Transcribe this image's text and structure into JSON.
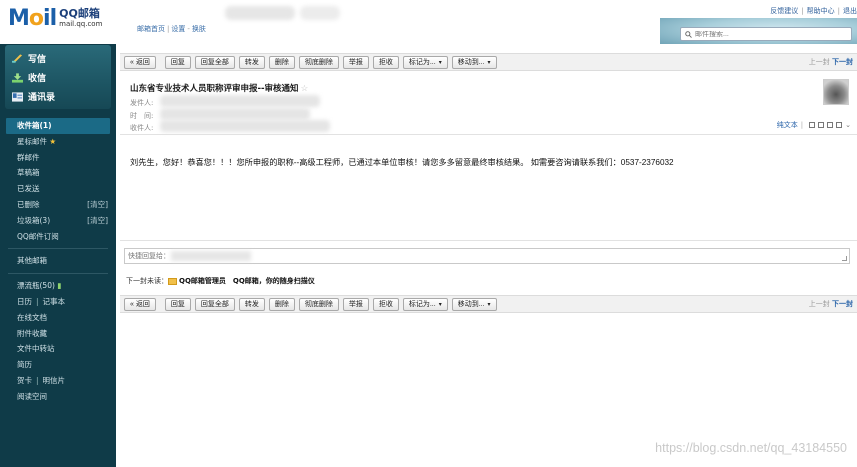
{
  "header": {
    "logo_mail": "MAil",
    "logo_cn": "QQ邮箱",
    "logo_url": "mail.qq.com",
    "links": [
      "邮箱首页",
      "设置",
      "换肤"
    ],
    "right_links": [
      "反馈建议",
      "帮助中心",
      "退出"
    ],
    "search_placeholder": "邮件搜索..."
  },
  "sidebar": {
    "compose": "写信",
    "inbox_quick": "收信",
    "contacts": "通讯录",
    "items": [
      {
        "label": "收件箱(1)",
        "active": true
      },
      {
        "label": "星标邮件"
      },
      {
        "label": "群邮件"
      },
      {
        "label": "草稿箱"
      },
      {
        "label": "已发送"
      },
      {
        "label": "已删除",
        "action": "[清空]"
      },
      {
        "label": "垃圾箱(3)",
        "action": "[清空]"
      },
      {
        "label": "QQ邮件订阅"
      }
    ],
    "other_mailbox": "其他邮箱",
    "drift_bottle": "漂流瓶(50)",
    "tools": [
      {
        "a": "日历",
        "b": "记事本"
      },
      {
        "a": "在线文档"
      },
      {
        "a": "附件收藏"
      },
      {
        "a": "文件中转站"
      },
      {
        "a": "简历"
      },
      {
        "a": "贺卡",
        "b": "明信片"
      },
      {
        "a": "阅读空间"
      }
    ]
  },
  "toolbar": {
    "back": "« 返回",
    "reply": "回复",
    "reply_all": "回复全部",
    "forward": "转发",
    "delete": "删除",
    "delete_perm": "彻底删除",
    "report": "举报",
    "reject": "拒收",
    "mark_as": "标记为...",
    "move_to": "移动到...",
    "prev": "上一封",
    "next": "下一封"
  },
  "mail": {
    "subject": "山东省专业技术人员职称评审申报--审核通知",
    "from_label": "发件人:",
    "time_label": "时　间:",
    "to_label": "收件人:",
    "plain_text": "纯文本",
    "body": "刘先生，您好！恭喜您！！！您所申报的职称--高级工程师，已通过本单位审核！请您多多留意最终审核结果。 如需要咨询请联系我们：0537-2376032"
  },
  "quick_reply": {
    "placeholder": "快捷回复给："
  },
  "next_mail": {
    "label": "下一封未读：",
    "sender": "QQ邮箱管理员",
    "subject": "QQ邮箱，你的随身扫描仪"
  },
  "watermark": "https://blog.csdn.net/qq_43184550"
}
